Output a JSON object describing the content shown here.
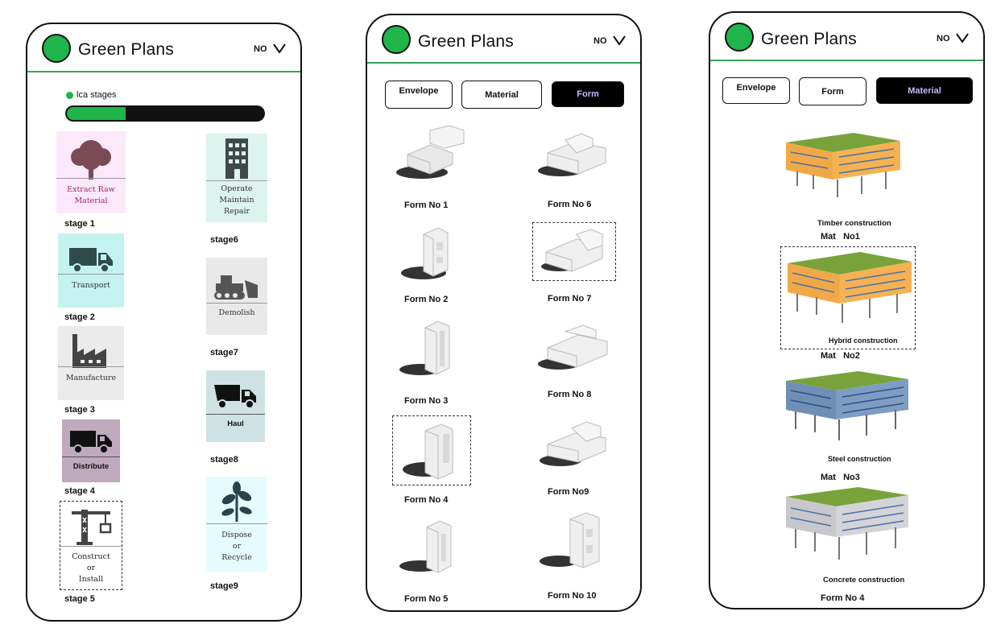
{
  "app": {
    "title": "Green Plans",
    "language": "NO"
  },
  "screen1": {
    "progress": {
      "label": "lca  stages",
      "fraction": 0.3
    },
    "stages": [
      {
        "caption": "Extract Raw\nMaterial",
        "label": "stage 1",
        "icon": "tree-icon",
        "bg": "#fbe9fb"
      },
      {
        "caption": "Transport",
        "label": "stage 2",
        "icon": "truck-icon",
        "bg": "#c4f3ef"
      },
      {
        "caption": "Manufacture",
        "label": "stage 3",
        "icon": "factory-icon",
        "bg": "#ebebeb"
      },
      {
        "caption": "Distribute",
        "label": "stage 4",
        "icon": "delivery-truck-icon",
        "bg": "#bfa9bd"
      },
      {
        "caption": "Construct\nor\nInstall",
        "label": "stage 5",
        "icon": "crane-icon",
        "bg": "#ffffff"
      },
      {
        "caption": "Operate\nMaintain\nRepair",
        "label": "stage6",
        "icon": "building-icon",
        "bg": "#dcf3ee"
      },
      {
        "caption": "Demolish",
        "label": "stage7",
        "icon": "bulldozer-icon",
        "bg": "#e9e9e9"
      },
      {
        "caption": "Haul",
        "label": "stage8",
        "icon": "dump-truck-icon",
        "bg": "#cfe2e3"
      },
      {
        "caption": "Dispose\nor\nRecycle",
        "label": "stage9",
        "icon": "plant-icon",
        "bg": "#e6fbfd"
      }
    ]
  },
  "screen2": {
    "tabs": [
      "Envelope",
      "Material",
      "Form"
    ],
    "active_tab": "Form",
    "forms": [
      "Form No 1",
      "Form No 2",
      "Form No 3",
      "Form No 4",
      "Form No 5",
      "Form No 6",
      "Form No 7",
      "Form No 8",
      "Form No9",
      "Form No 10"
    ]
  },
  "screen3": {
    "tabs": [
      "Envelope",
      "Form",
      "Material"
    ],
    "active_tab": "Material",
    "materials": [
      {
        "caption": "Timber construction",
        "label": "Mat   No1",
        "color": "#f2a94a"
      },
      {
        "caption": "Hybrid construction",
        "label": "Mat   No2",
        "color": "#f2a94a"
      },
      {
        "caption": "Steel construction",
        "label": "Mat   No3",
        "color": "#6f8fb5"
      },
      {
        "caption": "Concrete construction",
        "label": "Form No 4",
        "color": "#c8c8cc"
      }
    ]
  },
  "colors": {
    "brand_green": "#1fb54a",
    "active_tab_text": "#c9b6ff"
  }
}
